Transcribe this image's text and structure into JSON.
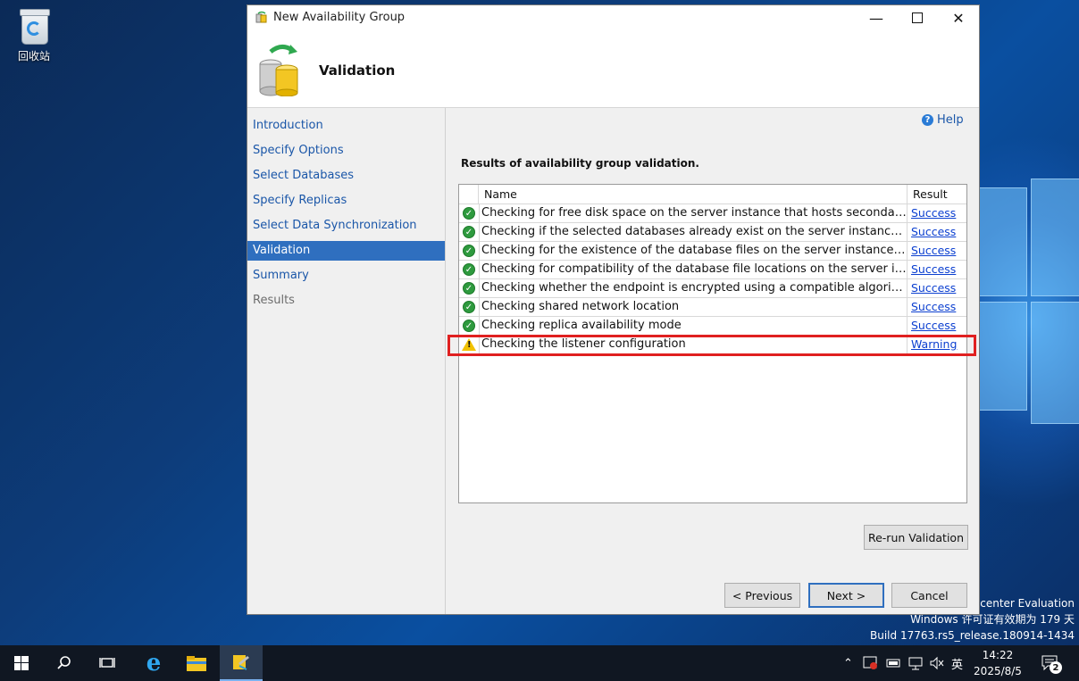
{
  "desktop": {
    "recycle_label": "回收站",
    "watermark": [
      "acenter Evaluation",
      "Windows 许可证有效期为 179 天",
      "Build 17763.rs5_release.180914-1434"
    ]
  },
  "dialog": {
    "title": "New Availability Group",
    "header_title": "Validation",
    "help_label": "Help",
    "nav": [
      {
        "label": "Introduction",
        "state": "link"
      },
      {
        "label": "Specify Options",
        "state": "link"
      },
      {
        "label": "Select Databases",
        "state": "link"
      },
      {
        "label": "Specify Replicas",
        "state": "link"
      },
      {
        "label": "Select Data Synchronization",
        "state": "link"
      },
      {
        "label": "Validation",
        "state": "active"
      },
      {
        "label": "Summary",
        "state": "link"
      },
      {
        "label": "Results",
        "state": "disabled"
      }
    ],
    "section_label": "Results of availability group validation.",
    "grid": {
      "columns": [
        "Name",
        "Result"
      ],
      "rows": [
        {
          "status": "success",
          "name": "Checking for free disk space on the server instance that hosts secondary replica",
          "result": "Success"
        },
        {
          "status": "success",
          "name": "Checking if the selected databases already exist on the server instance that hosts",
          "result": "Success"
        },
        {
          "status": "success",
          "name": "Checking for the existence of the database files on the server instance that hosts",
          "result": "Success"
        },
        {
          "status": "success",
          "name": "Checking for compatibility of the database file locations on the server instance",
          "result": "Success"
        },
        {
          "status": "success",
          "name": "Checking whether the endpoint is encrypted using a compatible algorithm",
          "result": "Success"
        },
        {
          "status": "success",
          "name": "Checking shared network location",
          "result": "Success"
        },
        {
          "status": "success",
          "name": "Checking replica availability mode",
          "result": "Success"
        },
        {
          "status": "warning",
          "name": "Checking the listener configuration",
          "result": "Warning"
        }
      ]
    },
    "buttons": {
      "rerun": "Re-run Validation",
      "previous": "< Previous",
      "next": "Next >",
      "cancel": "Cancel"
    }
  },
  "taskbar": {
    "ime": "英",
    "time": "14:22",
    "date": "2025/8/5",
    "notification_count": "2"
  }
}
